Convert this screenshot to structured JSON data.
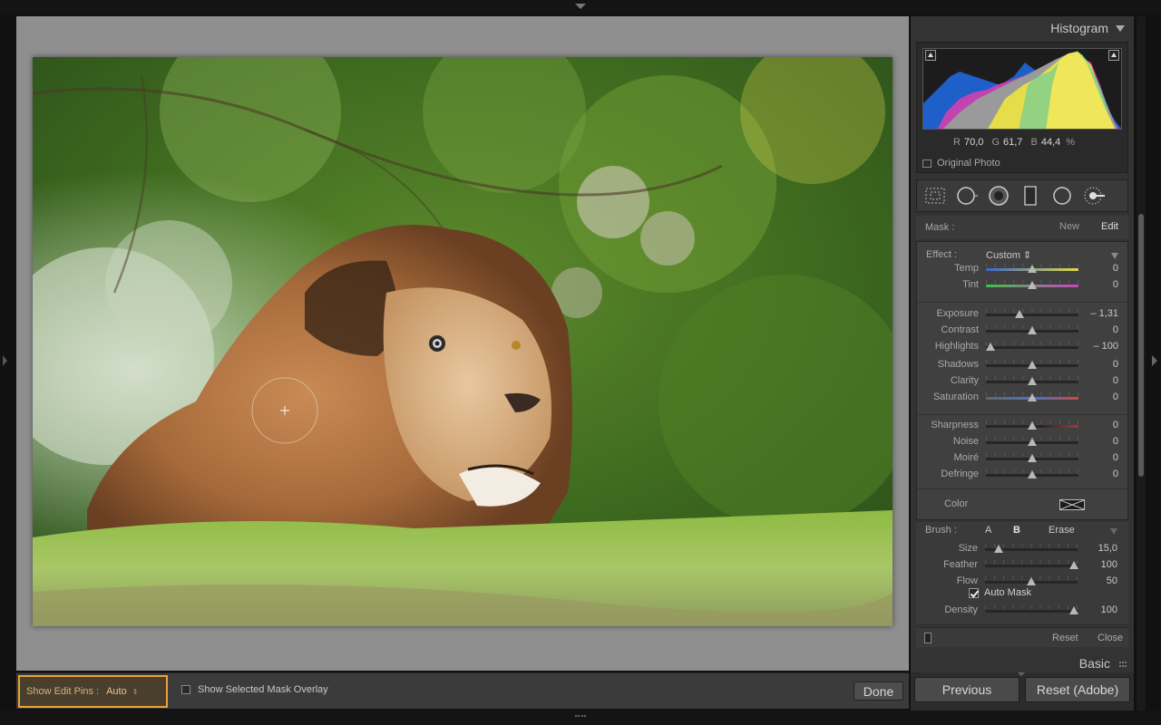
{
  "canvas": {
    "show_edit_pins_label": "Show Edit Pins :",
    "show_edit_pins_value": "Auto",
    "show_mask_overlay_label": "Show Selected Mask Overlay",
    "done_label": "Done"
  },
  "histogram": {
    "title": "Histogram",
    "r_label": "R",
    "r_value": "70,0",
    "g_label": "G",
    "g_value": "61,7",
    "b_label": "B",
    "b_value": "44,4",
    "percent": "%",
    "original_photo_label": "Original Photo"
  },
  "tools": [
    "crop-overlay-icon",
    "spot-removal-icon",
    "red-eye-icon",
    "graduated-filter-icon",
    "radial-filter-icon",
    "adjustment-brush-icon"
  ],
  "mask": {
    "label": "Mask :",
    "new_label": "New",
    "edit_label": "Edit"
  },
  "effect": {
    "label": "Effect :",
    "value": "Custom",
    "sliders": [
      {
        "name": "Temp",
        "value": "0",
        "level": 0.5
      },
      {
        "name": "Tint",
        "value": "0",
        "level": 0.5
      },
      {
        "name": "Exposure",
        "value": "– 1,31",
        "level": 0.36
      },
      {
        "name": "Contrast",
        "value": "0",
        "level": 0.5
      },
      {
        "name": "Highlights",
        "value": "– 100",
        "level": 0.05
      },
      {
        "name": "Shadows",
        "value": "0",
        "level": 0.5
      },
      {
        "name": "Clarity",
        "value": "0",
        "level": 0.5
      },
      {
        "name": "Saturation",
        "value": "0",
        "level": 0.5
      },
      {
        "name": "Sharpness",
        "value": "0",
        "level": 0.5
      },
      {
        "name": "Noise",
        "value": "0",
        "level": 0.5
      },
      {
        "name": "Moiré",
        "value": "0",
        "level": 0.5
      },
      {
        "name": "Defringe",
        "value": "0",
        "level": 0.5
      }
    ],
    "color_label": "Color"
  },
  "brush": {
    "label": "Brush :",
    "a_label": "A",
    "b_label": "B",
    "erase_label": "Erase",
    "sliders": [
      {
        "name": "Size",
        "value": "15,0",
        "level": 0.15
      },
      {
        "name": "Feather",
        "value": "100",
        "level": 0.96
      },
      {
        "name": "Flow",
        "value": "50",
        "level": 0.5
      },
      {
        "name": "Density",
        "value": "100",
        "level": 0.96
      }
    ],
    "auto_mask_label": "Auto Mask",
    "auto_mask_checked": true
  },
  "panel_footer": {
    "reset_label": "Reset",
    "close_label": "Close"
  },
  "basic": {
    "title": "Basic"
  },
  "nav": {
    "previous_label": "Previous",
    "reset_adobe_label": "Reset (Adobe)"
  },
  "colors": {
    "accent": "#e8a33a",
    "panel": "#333333",
    "canvas": "#8f8f8f"
  }
}
